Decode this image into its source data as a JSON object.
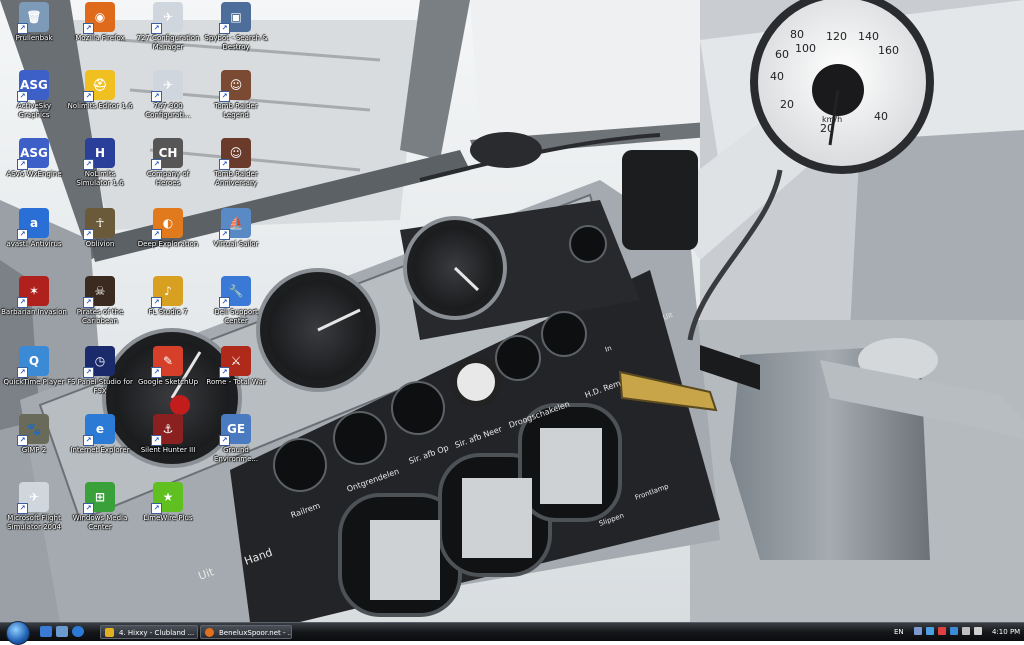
{
  "desktop": {
    "icons": [
      {
        "label": "Prullenbak",
        "glyph": "🗑",
        "color": "#7d9ab8",
        "icon": "recycle-bin-icon"
      },
      {
        "label": "Mozilla Firefox",
        "glyph": "◉",
        "color": "#e06a1c",
        "icon": "firefox-icon"
      },
      {
        "label": "727 Configuration Manager",
        "glyph": "✈",
        "color": "#cfd6de",
        "icon": "airplane-icon"
      },
      {
        "label": "Spybot - Search & Destroy",
        "glyph": "▣",
        "color": "#4d6d9a",
        "icon": "spybot-icon"
      },
      {
        "label": "ActiveSky Graphics",
        "glyph": "ASG",
        "color": "#3d5fc8",
        "icon": "asg-icon"
      },
      {
        "label": "Nolimits Editor 1.6",
        "glyph": "⛑",
        "color": "#f0c020",
        "icon": "hardhat-icon"
      },
      {
        "label": "767-300 Configurati...",
        "glyph": "✈",
        "color": "#cfd6de",
        "icon": "airplane-icon"
      },
      {
        "label": "Tomb Raider Legend",
        "glyph": "☺",
        "color": "#7a4a32",
        "icon": "tomb-raider-icon"
      },
      {
        "label": "ASv6 WxEngine",
        "glyph": "ASG",
        "color": "#3d5fc8",
        "icon": "asg-icon"
      },
      {
        "label": "NoLimits Simulator 1.6",
        "glyph": "H",
        "color": "#2a3f9a",
        "icon": "nolimits-icon"
      },
      {
        "label": "Company of Heroes",
        "glyph": "CH",
        "color": "#565656",
        "icon": "coh-icon"
      },
      {
        "label": "Tomb Raider Anniversary",
        "glyph": "☺",
        "color": "#6a3a2a",
        "icon": "tomb-raider-icon"
      },
      {
        "label": "avast! Antivirus",
        "glyph": "a",
        "color": "#2a6fd6",
        "icon": "avast-icon"
      },
      {
        "label": "Oblivion",
        "glyph": "☥",
        "color": "#6a5a3a",
        "icon": "oblivion-icon"
      },
      {
        "label": "Deep Exploration",
        "glyph": "◐",
        "color": "#e07a1c",
        "icon": "deep-exploration-icon"
      },
      {
        "label": "Virtual Sailor",
        "glyph": "⛵",
        "color": "#5a8ac6",
        "icon": "sailor-icon"
      },
      {
        "label": "Barbarian Invasion",
        "glyph": "✶",
        "color": "#b0201c",
        "icon": "barbarian-icon"
      },
      {
        "label": "Pirates of the Caribbean",
        "glyph": "☠",
        "color": "#3a2a20",
        "icon": "pirates-icon"
      },
      {
        "label": "FL Studio 7",
        "glyph": "♪",
        "color": "#d8a020",
        "icon": "fl-studio-icon"
      },
      {
        "label": "Dell Support Center",
        "glyph": "🔧",
        "color": "#3a7ad6",
        "icon": "wrench-icon"
      },
      {
        "label": "QuickTime Player",
        "glyph": "Q",
        "color": "#3a8ad6",
        "icon": "quicktime-icon"
      },
      {
        "label": "FS Panel Studio for FSX",
        "glyph": "◷",
        "color": "#1a2a6a",
        "icon": "panel-studio-icon"
      },
      {
        "label": "Google SketchUp",
        "glyph": "✎",
        "color": "#d6402a",
        "icon": "sketchup-icon"
      },
      {
        "label": "Rome - Total War",
        "glyph": "⚔",
        "color": "#b02a1c",
        "icon": "rome-icon"
      },
      {
        "label": "GIMP 2",
        "glyph": "🐾",
        "color": "#6a6a5a",
        "icon": "gimp-icon"
      },
      {
        "label": "Internet Explorer",
        "glyph": "e",
        "color": "#2a7ad6",
        "icon": "ie-icon"
      },
      {
        "label": "Silent Hunter III",
        "glyph": "⚓",
        "color": "#8a2020",
        "icon": "silent-hunter-icon"
      },
      {
        "label": "Ground Environme...",
        "glyph": "GE",
        "color": "#4a7ac0",
        "icon": "ge-icon"
      },
      {
        "label": "Microsoft Flight Simulator 2004",
        "glyph": "✈",
        "color": "#d0d6de",
        "icon": "flight-sim-icon"
      },
      {
        "label": "Windows Media Center",
        "glyph": "⊞",
        "color": "#3aa03a",
        "icon": "media-center-icon"
      },
      {
        "label": "LimeWire Plus",
        "glyph": "★",
        "color": "#60c020",
        "icon": "limewire-icon"
      }
    ]
  },
  "taskbar": {
    "buttons": [
      {
        "label": "4. Hixxy - Clubland ...",
        "color": "#e0b020"
      },
      {
        "label": "BeneluxSpoor.net - ...",
        "color": "#e07020"
      }
    ],
    "tray": {
      "language": "EN",
      "clock": "4:10 PM"
    }
  },
  "wallpaper": {
    "gauge_labels": {
      "speed_unit": "km/h",
      "ticks": [
        "20",
        "40",
        "60",
        "80",
        "100",
        "120",
        "140",
        "160",
        "20",
        "40"
      ],
      "panel_words": [
        "Railrem",
        "Ontgrendelen",
        "Sir. afb Op",
        "Sir. afb Neer",
        "Droogschakelen",
        "H.D. Rem",
        "Uit",
        "Hand",
        "Slippen",
        "Frontlamp",
        "In",
        "Uit"
      ]
    },
    "colors": {
      "sky": "#e8ecef",
      "panel": "#26272a",
      "metal": "#9aa0a6",
      "cab": "#c8ccd0"
    }
  }
}
